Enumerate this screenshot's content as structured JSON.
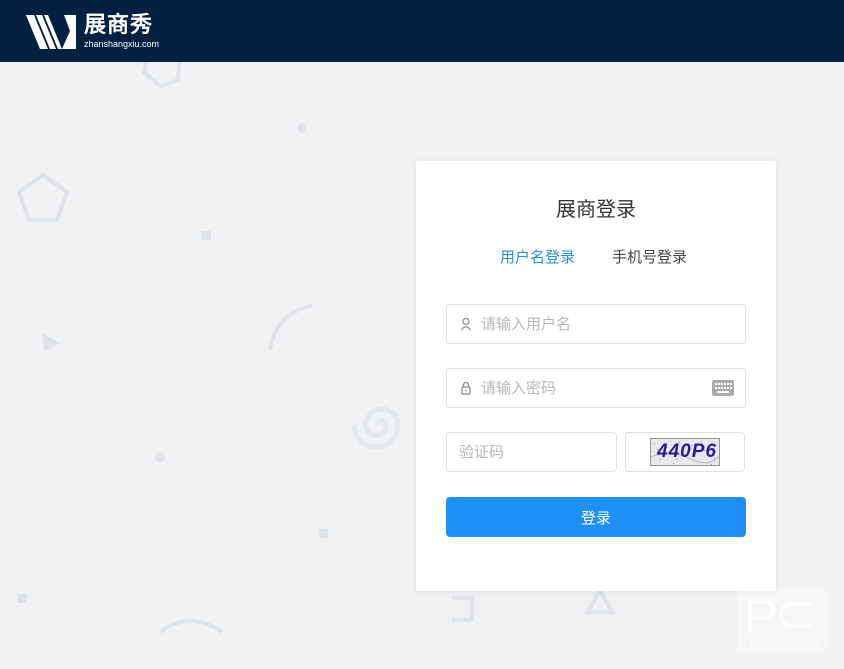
{
  "header": {
    "brand_name": "展商秀",
    "brand_url": "zhanshangxiu.com"
  },
  "login": {
    "title": "展商登录",
    "tabs": [
      {
        "label": "用户名登录",
        "active": true
      },
      {
        "label": "手机号登录",
        "active": false
      }
    ],
    "username_placeholder": "请输入用户名",
    "password_placeholder": "请输入密码",
    "captcha_placeholder": "验证码",
    "captcha_code": "440P6",
    "submit_label": "登录"
  },
  "watermark": {
    "text": "PHPCAMS.CN"
  },
  "icons": {
    "username": "user-icon",
    "password": "lock-icon",
    "keyboard": "keyboard-icon"
  },
  "colors": {
    "header_bg": "#052141",
    "page_bg": "#f1f2f4",
    "accent": "#1e90f5",
    "active_tab": "#2a8ed8"
  }
}
